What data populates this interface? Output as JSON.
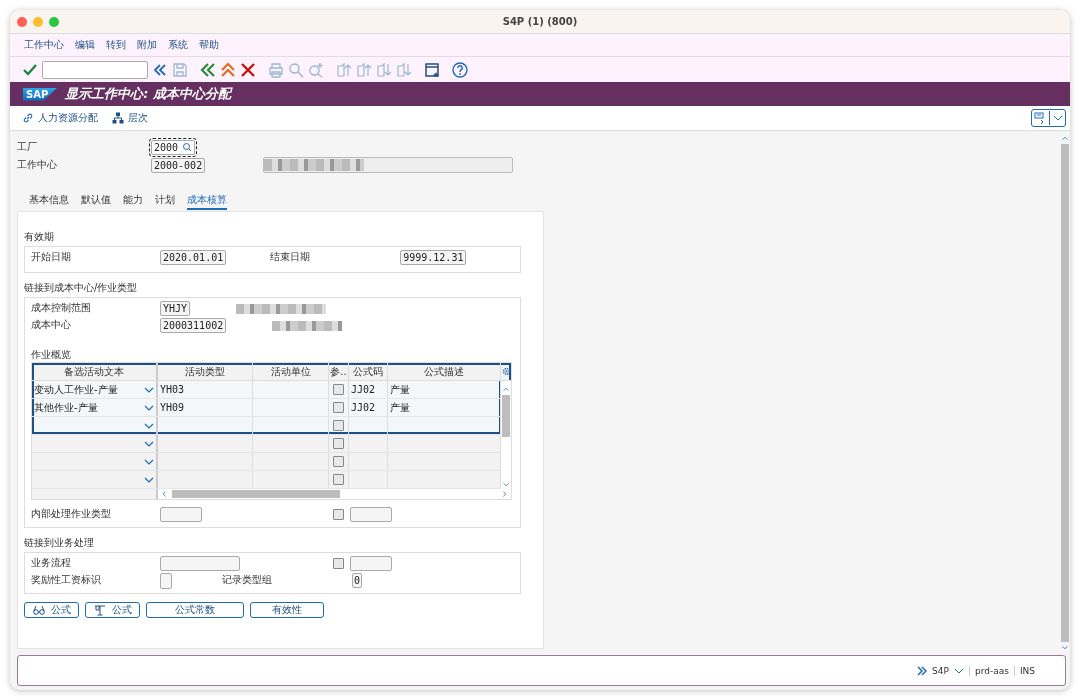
{
  "window": {
    "title": "S4P (1) (800)"
  },
  "menu": [
    "工作中心",
    "编辑",
    "转到",
    "附加",
    "系统",
    "帮助"
  ],
  "title_bar": {
    "logo": "SAP",
    "title": "显示工作中心: 成本中心分配"
  },
  "app_toolbar": [
    {
      "kind": "link",
      "label": "人力资源分配"
    },
    {
      "kind": "hierarchy",
      "label": "层次"
    }
  ],
  "header_fields": [
    {
      "label": "工厂",
      "value": "2000",
      "focused": true
    },
    {
      "label": "工作中心",
      "value": "2000-002",
      "focused": false
    }
  ],
  "tabs": [
    {
      "label": "基本信息",
      "selected": false
    },
    {
      "label": "默认值",
      "selected": false
    },
    {
      "label": "能力",
      "selected": false
    },
    {
      "label": "计划",
      "selected": false
    },
    {
      "label": "成本核算",
      "selected": true
    }
  ],
  "validity": {
    "title": "有效期",
    "start_label": "开始日期",
    "start": "2020.01.01",
    "end_label": "结束日期",
    "end": "9999.12.31"
  },
  "cost_link": {
    "title": "链接到成本中心/作业类型",
    "fields": [
      {
        "label": "成本控制范围",
        "value": "YHJY"
      },
      {
        "label": "成本中心",
        "value": "2000311002"
      }
    ]
  },
  "activity_overview": {
    "title": "作业概览",
    "columns": [
      "备选活动文本",
      "活动类型",
      "活动单位",
      "参..",
      "公式码",
      "公式描述"
    ],
    "rows": [
      {
        "selected": true,
        "alt_text": "变动人工作业-产量",
        "activity_type": "YH03",
        "checked": false,
        "formula_code": "JJ02",
        "formula_desc": "产量"
      },
      {
        "selected": true,
        "alt_text": "其他作业-产量",
        "activity_type": "YH09",
        "checked": false,
        "formula_code": "JJ02",
        "formula_desc": "产量"
      },
      {
        "selected": true,
        "checked": false
      },
      {
        "selected": false,
        "checked": false
      },
      {
        "selected": false,
        "checked": false
      },
      {
        "selected": false,
        "checked": false
      }
    ]
  },
  "internal": {
    "label": "内部处理作业类型",
    "checked": false
  },
  "business": {
    "title": "链接到业务处理",
    "process_label": "业务流程",
    "process_checked": false,
    "incentive_label": "奖励性工资标识",
    "record_label": "记录类型组",
    "record_value": "0"
  },
  "buttons": [
    {
      "kind": "glasses",
      "label": "公式"
    },
    {
      "kind": "scale",
      "label": "公式"
    },
    {
      "kind": "plain",
      "label": "公式常数"
    },
    {
      "kind": "plain",
      "label": "有效性"
    }
  ],
  "status": {
    "system": "S4P",
    "server": "prd-aas",
    "mode": "INS"
  }
}
